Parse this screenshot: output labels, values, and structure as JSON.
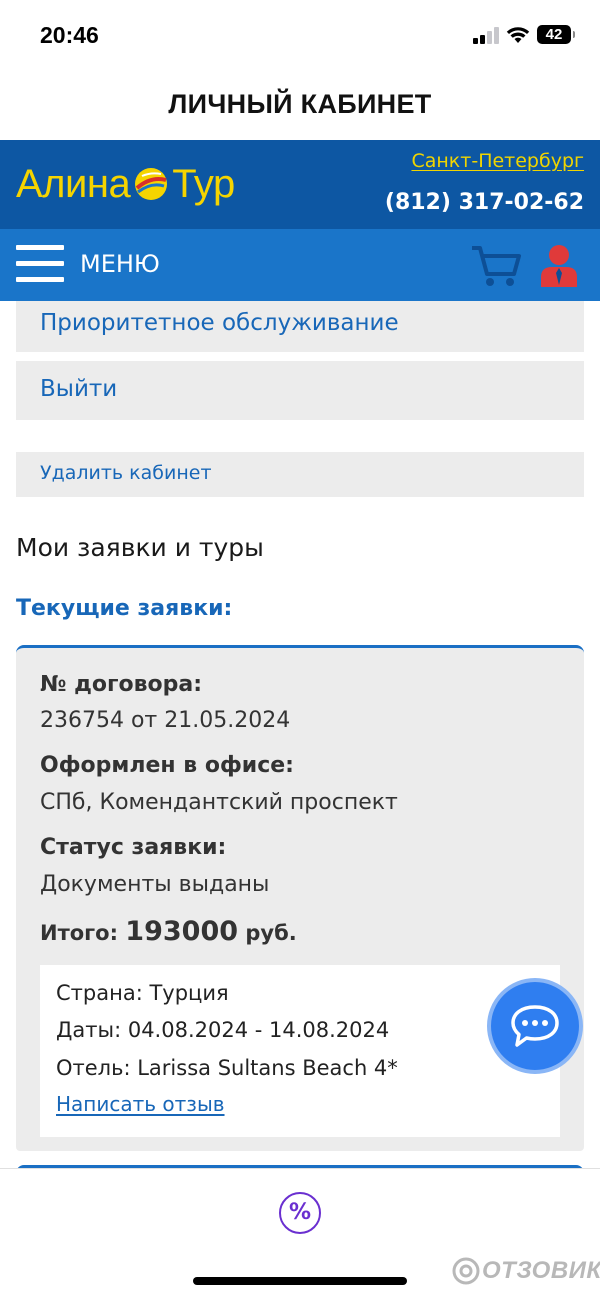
{
  "status_bar": {
    "time": "20:46",
    "battery": "42"
  },
  "page_heading": "ЛИЧНЫЙ КАБИНЕТ",
  "header": {
    "logo_left": "Алина",
    "logo_right": "Тур",
    "city": "Санкт-Петербург",
    "phone": "(812) 317-02-62"
  },
  "navbar": {
    "menu_label": "МЕНЮ"
  },
  "menu_items": [
    {
      "label": "Приоритетное обслуживание"
    },
    {
      "label": "Выйти"
    },
    {
      "label": "Удалить кабинет"
    }
  ],
  "section_title": "Мои заявки и туры",
  "current_orders_title": "Текущие заявки:",
  "order": {
    "contract_label": "№ договора:",
    "contract_value": "236754 от 21.05.2024",
    "office_label": "Оформлен в офисе:",
    "office_value": "СПб, Комендантский проспект",
    "status_label": "Статус заявки:",
    "status_value": "Документы выданы",
    "total_label": "Итого:",
    "total_amount": "193000",
    "total_currency": "руб.",
    "country": "Страна: Турция",
    "dates": "Даты: 04.08.2024 - 14.08.2024",
    "hotel": "Отель: Larissa Sultans Beach 4*",
    "review_link": "Написать отзыв"
  },
  "bottom": {
    "percent_icon": "%"
  },
  "watermark": "ОТЗОВИК",
  "colors": {
    "header_bg": "#0d57a3",
    "navbar_bg": "#1a75c9",
    "logo_yellow": "#f5d400",
    "link_blue": "#1867b8",
    "card_bg": "#ececec",
    "chat_blue": "#2f7ef0",
    "user_red": "#e03a3a"
  }
}
